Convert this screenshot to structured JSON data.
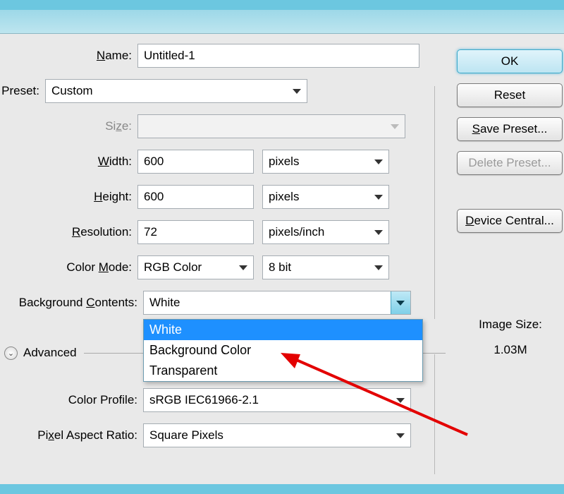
{
  "labels": {
    "name": "Name:",
    "preset": "Preset:",
    "size": "Size:",
    "width": "Width:",
    "height": "Height:",
    "resolution": "Resolution:",
    "color_mode": "Color Mode:",
    "bg_contents": "Background Contents:",
    "advanced": "Advanced",
    "color_profile": "Color Profile:",
    "pixel_aspect": "Pixel Aspect Ratio:"
  },
  "fields": {
    "name": "Untitled-1",
    "preset": "Custom",
    "size": "",
    "width": "600",
    "width_unit": "pixels",
    "height": "600",
    "height_unit": "pixels",
    "resolution": "72",
    "resolution_unit": "pixels/inch",
    "color_mode": "RGB Color",
    "bit_depth": "8 bit",
    "bg_contents": "White",
    "color_profile": "sRGB IEC61966-2.1",
    "pixel_aspect": "Square Pixels"
  },
  "bg_contents_options": {
    "o1": "White",
    "o2": "Background Color",
    "o3": "Transparent"
  },
  "side": {
    "ok": "OK",
    "reset": "Reset",
    "save_preset": "Save Preset...",
    "delete_preset": "Delete Preset...",
    "device_central": "Device Central...",
    "image_size_label": "Image Size:",
    "image_size_value": "1.03M"
  }
}
